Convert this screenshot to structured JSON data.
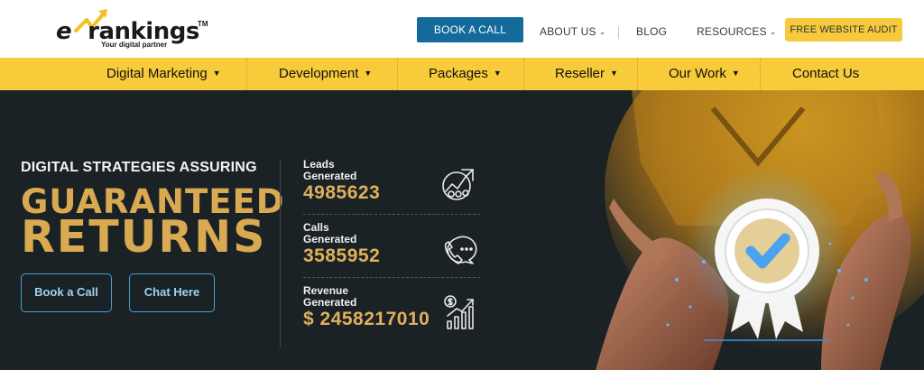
{
  "logo": {
    "brand": "rankings",
    "brand_prefix": "e",
    "trademark": "TM",
    "tagline": "Your digital partner"
  },
  "header": {
    "book_call_label": "BOOK A CALL",
    "about_label": "ABOUT US",
    "blog_label": "BLOG",
    "resources_label": "RESOURCES",
    "audit_label": "FREE WEBSITE AUDIT"
  },
  "menu": {
    "items": [
      {
        "label": "Digital Marketing"
      },
      {
        "label": "Development"
      },
      {
        "label": "Packages"
      },
      {
        "label": "Reseller"
      },
      {
        "label": "Our Work"
      },
      {
        "label": "Contact Us"
      }
    ]
  },
  "hero": {
    "subtitle": "DIGITAL STRATEGIES ASSURING",
    "headline_1": "GUARANTEED",
    "headline_2": "RETURNS",
    "book_label": "Book a Call",
    "chat_label": "Chat Here"
  },
  "stats": [
    {
      "label_1": "Leads",
      "label_2": "Generated",
      "value": "4985623",
      "icon": "leads-graph-icon"
    },
    {
      "label_1": "Calls",
      "label_2": "Generated",
      "value": "3585952",
      "icon": "phone-chat-icon"
    },
    {
      "label_1": "Revenue",
      "label_2": "Generated",
      "value": "$ 2458217010",
      "icon": "revenue-chart-icon"
    }
  ],
  "colors": {
    "brand_yellow": "#f7cb3a",
    "button_blue": "#146a9b",
    "hero_bg": "#1b2226",
    "gold_text": "#d9aa52"
  }
}
